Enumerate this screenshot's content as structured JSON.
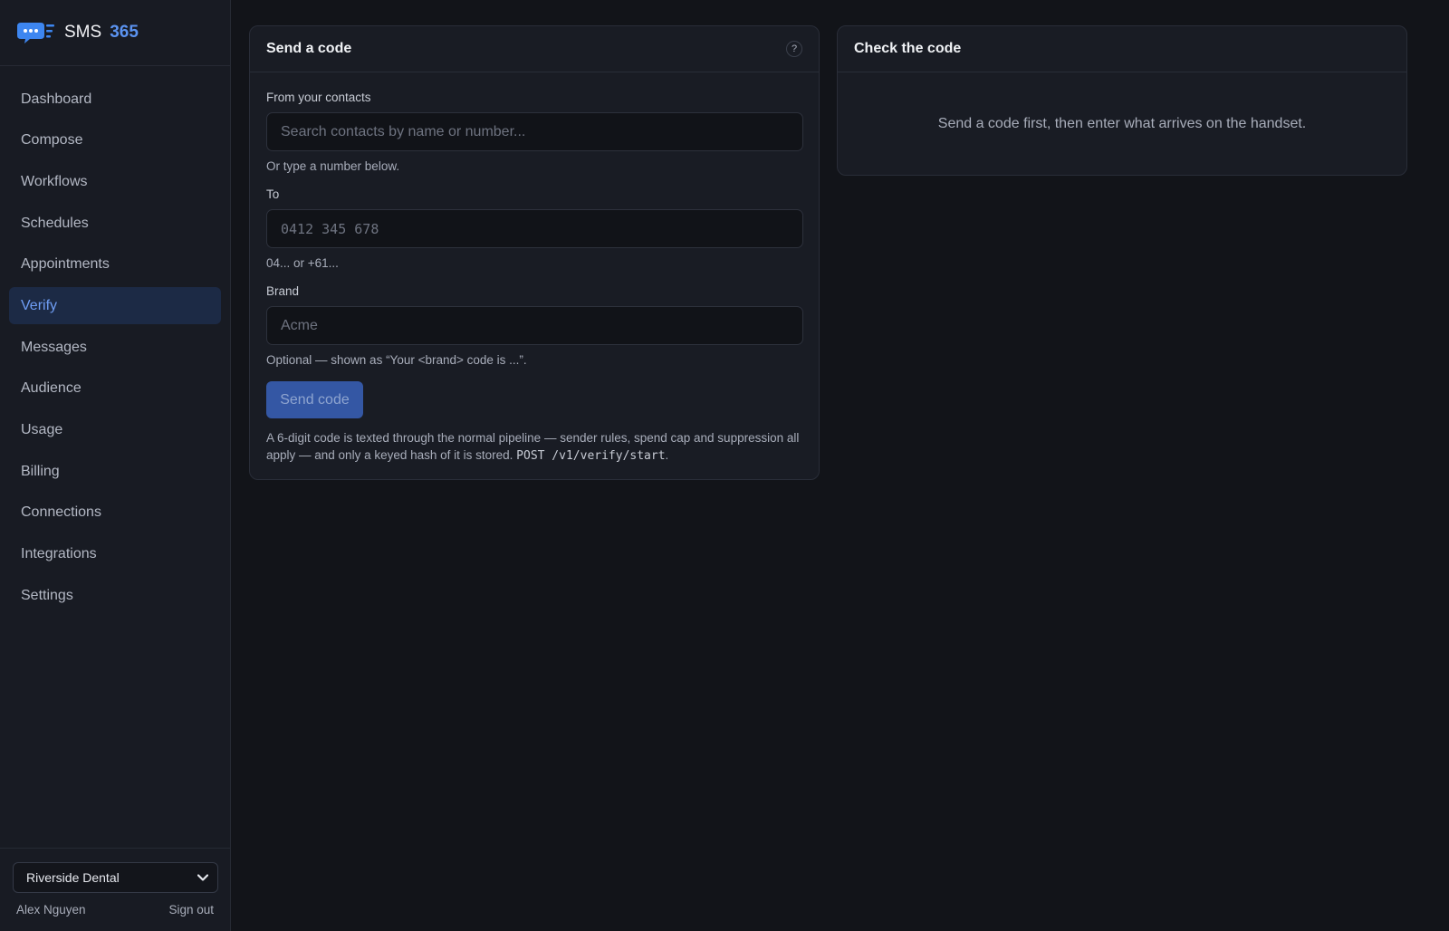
{
  "app": {
    "brand_name": "SMS",
    "brand_number": "365",
    "accent": "#5b93f0"
  },
  "sidebar": {
    "items": [
      {
        "label": "Dashboard",
        "active": false
      },
      {
        "label": "Compose",
        "active": false
      },
      {
        "label": "Workflows",
        "active": false
      },
      {
        "label": "Schedules",
        "active": false
      },
      {
        "label": "Appointments",
        "active": false
      },
      {
        "label": "Verify",
        "active": true
      },
      {
        "label": "Messages",
        "active": false
      },
      {
        "label": "Audience",
        "active": false
      },
      {
        "label": "Usage",
        "active": false
      },
      {
        "label": "Billing",
        "active": false
      },
      {
        "label": "Connections",
        "active": false
      },
      {
        "label": "Integrations",
        "active": false
      },
      {
        "label": "Settings",
        "active": false
      }
    ],
    "org_select": "Riverside Dental",
    "user_name": "Alex Nguyen",
    "sign_out": "Sign out"
  },
  "send_card": {
    "title": "Send a code",
    "help": "?",
    "contacts_label": "From your contacts",
    "contacts_placeholder": "Search contacts by name or number...",
    "contacts_hint": "Or type a number below.",
    "to_label": "To",
    "to_placeholder": "0412 345 678",
    "to_hint": "04... or +61...",
    "brand_label": "Brand",
    "brand_placeholder": "Acme",
    "brand_hint": "Optional — shown as “Your <brand> code is ...”.",
    "send_button": "Send code",
    "footnote_text": "A 6-digit code is texted through the normal pipeline — sender rules, spend cap and suppression all apply — and only a keyed hash of it is stored.",
    "footnote_code": "POST /v1/verify/start",
    "footnote_end": "."
  },
  "check_card": {
    "title": "Check the code",
    "message": "Send a code first, then enter what arrives on the handset."
  }
}
